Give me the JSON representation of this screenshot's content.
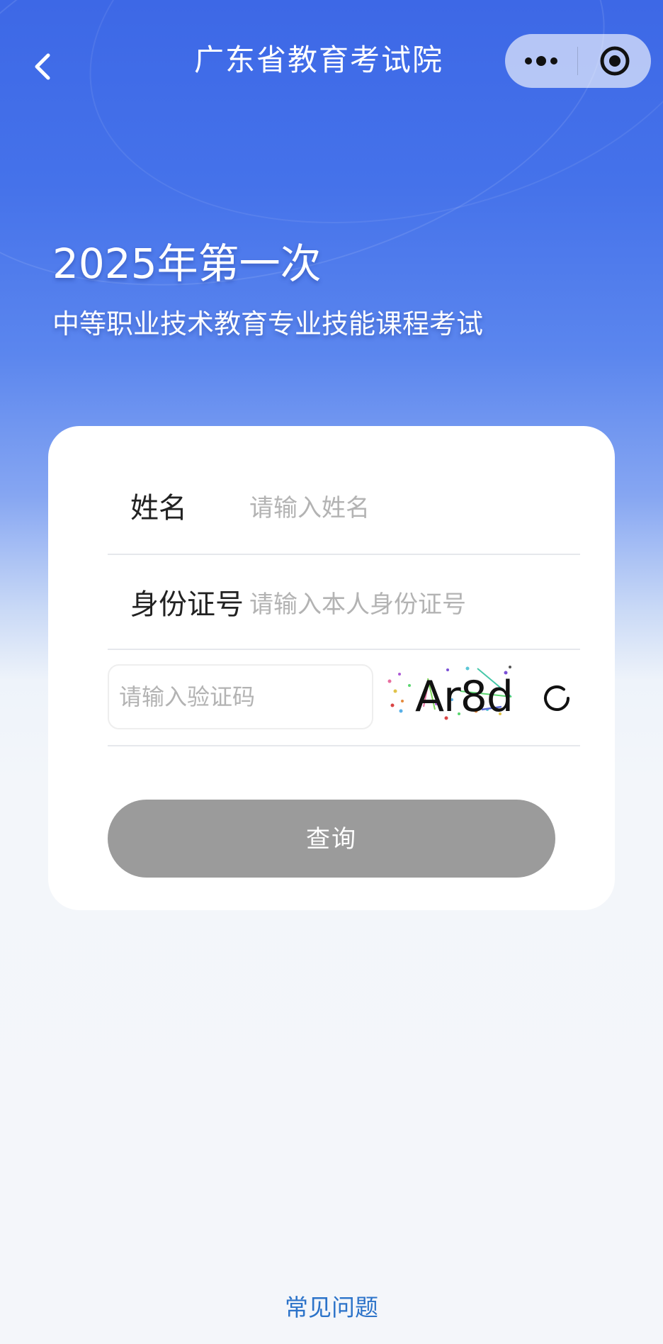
{
  "header": {
    "title": "广东省教育考试院",
    "back_icon": "chevron-left-icon",
    "more_icon": "more-dots-icon",
    "close_icon": "target-circle-icon"
  },
  "hero": {
    "title": "2025年第一次",
    "subtitle": "中等职业技术教育专业技能课程考试"
  },
  "form": {
    "name_label": "姓名",
    "name_placeholder": "请输入姓名",
    "id_label": "身份证号",
    "id_placeholder": "请输入本人身份证号",
    "captcha_placeholder": "请输入验证码",
    "captcha_text": "Ar8d",
    "refresh_icon": "refresh-icon",
    "submit_label": "查询"
  },
  "footer": {
    "faq_label": "常见问题"
  },
  "colors": {
    "primary_blue": "#3d68e6",
    "button_disabled": "#9b9b9b",
    "link": "#2c73c9",
    "card": "#ffffff"
  }
}
